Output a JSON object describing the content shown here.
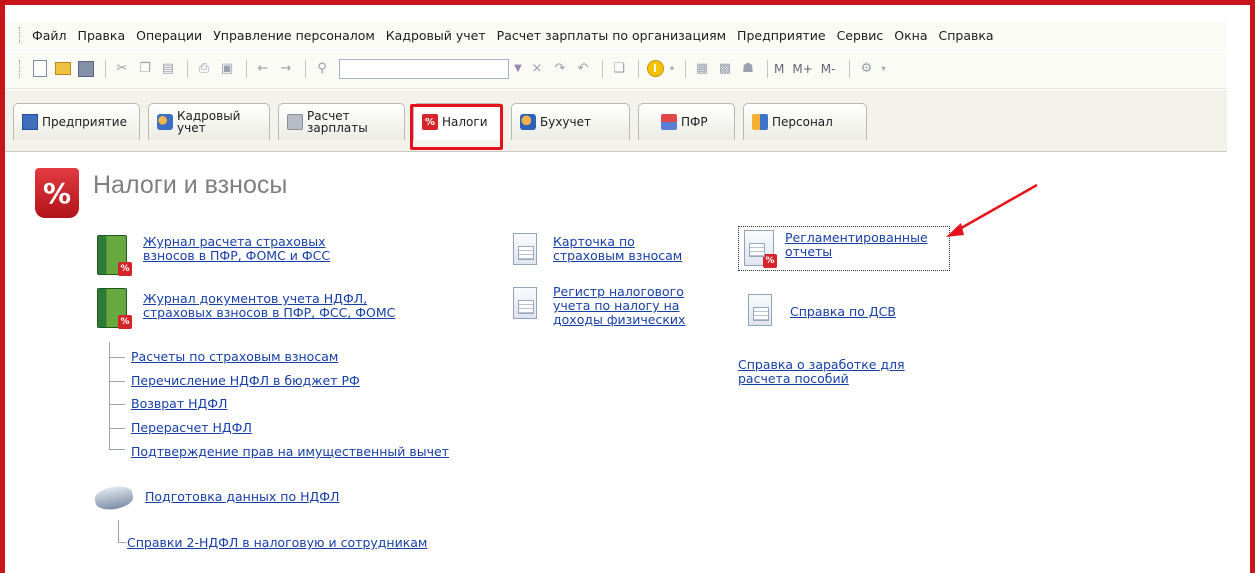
{
  "colors": {
    "frame": "#c8141b",
    "link": "#173fa6",
    "highlight": "#e5111b",
    "title": "#7f7f7f"
  },
  "menu": {
    "items": [
      "Файл",
      "Правка",
      "Операции",
      "Управление персоналом",
      "Кадровый учет",
      "Расчет зарплаты по организациям",
      "Предприятие",
      "Сервис",
      "Окна",
      "Справка"
    ]
  },
  "toolbar": {
    "search_value": "",
    "memory_buttons": [
      "M",
      "M+",
      "M-"
    ]
  },
  "tabs": [
    {
      "label": "Предприятие",
      "icon": "enterprise-icon"
    },
    {
      "label_1": "Кадровый",
      "label_2": "учет",
      "icon": "personnel-icon"
    },
    {
      "label_1": "Расчет",
      "label_2": "зарплаты",
      "icon": "payroll-icon"
    },
    {
      "label": "Налоги",
      "icon": "percent-icon",
      "active": true
    },
    {
      "label": "Бухучет",
      "icon": "accounting-icon"
    },
    {
      "label": "ПФР",
      "icon": "pension-fund-icon"
    },
    {
      "label": "Персонал",
      "icon": "staff-icon"
    }
  ],
  "section": {
    "title": "Налоги и взносы",
    "icon": "percent-icon"
  },
  "col1": {
    "journal1": {
      "line1": "Журнал расчета страховых",
      "line2": "взносов в ПФР, ФОМС и ФСС"
    },
    "journal2": {
      "line1": "Журнал документов учета НДФЛ,",
      "line2": "страховых взносов в ПФР, ФСС, ФОМС"
    },
    "subitems": [
      "Расчеты по страховым взносам",
      "Перечисление НДФЛ в бюджет РФ",
      "Возврат НДФЛ",
      "Перерасчет НДФЛ",
      "Подтверждение прав на имущественный вычет"
    ],
    "prep": "Подготовка данных по НДФЛ",
    "prep_sub": "Справки 2-НДФЛ в налоговую и сотрудникам"
  },
  "col2": {
    "card": {
      "line1": "Карточка по",
      "line2": "страховым взносам"
    },
    "register": {
      "line1": "Регистр налогового",
      "line2": "учета по налогу на",
      "line3": "доходы физических"
    }
  },
  "col3": {
    "reports": {
      "line1": "Регламентированные",
      "line2": "отчеты"
    },
    "dsv": "Справка по ДСВ",
    "earnings": {
      "line1": "Справка о заработке для",
      "line2": "расчета пособий"
    }
  }
}
